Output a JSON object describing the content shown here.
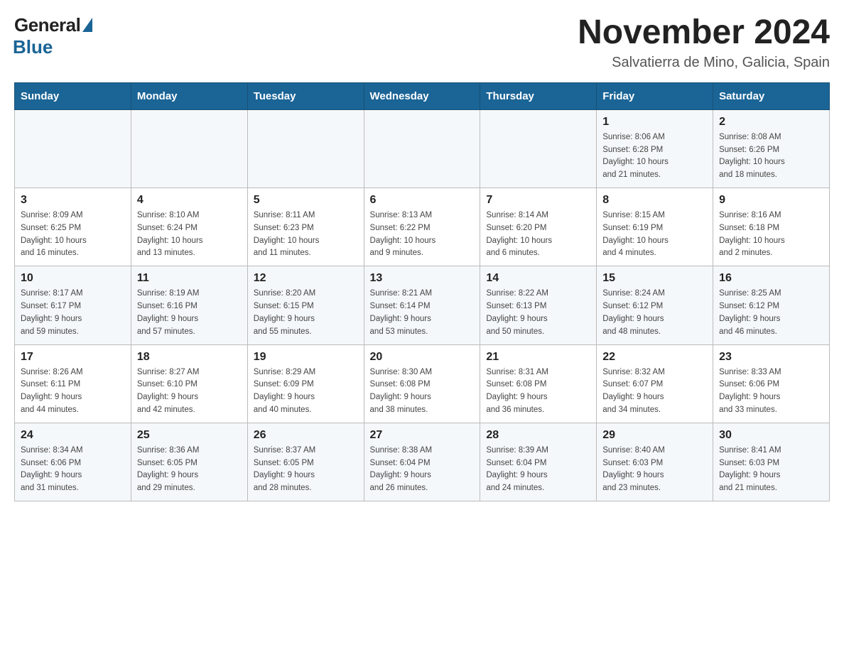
{
  "logo": {
    "general": "General",
    "blue": "Blue"
  },
  "header": {
    "title": "November 2024",
    "subtitle": "Salvatierra de Mino, Galicia, Spain"
  },
  "days_of_week": [
    "Sunday",
    "Monday",
    "Tuesday",
    "Wednesday",
    "Thursday",
    "Friday",
    "Saturday"
  ],
  "weeks": [
    [
      {
        "day": "",
        "info": ""
      },
      {
        "day": "",
        "info": ""
      },
      {
        "day": "",
        "info": ""
      },
      {
        "day": "",
        "info": ""
      },
      {
        "day": "",
        "info": ""
      },
      {
        "day": "1",
        "info": "Sunrise: 8:06 AM\nSunset: 6:28 PM\nDaylight: 10 hours\nand 21 minutes."
      },
      {
        "day": "2",
        "info": "Sunrise: 8:08 AM\nSunset: 6:26 PM\nDaylight: 10 hours\nand 18 minutes."
      }
    ],
    [
      {
        "day": "3",
        "info": "Sunrise: 8:09 AM\nSunset: 6:25 PM\nDaylight: 10 hours\nand 16 minutes."
      },
      {
        "day": "4",
        "info": "Sunrise: 8:10 AM\nSunset: 6:24 PM\nDaylight: 10 hours\nand 13 minutes."
      },
      {
        "day": "5",
        "info": "Sunrise: 8:11 AM\nSunset: 6:23 PM\nDaylight: 10 hours\nand 11 minutes."
      },
      {
        "day": "6",
        "info": "Sunrise: 8:13 AM\nSunset: 6:22 PM\nDaylight: 10 hours\nand 9 minutes."
      },
      {
        "day": "7",
        "info": "Sunrise: 8:14 AM\nSunset: 6:20 PM\nDaylight: 10 hours\nand 6 minutes."
      },
      {
        "day": "8",
        "info": "Sunrise: 8:15 AM\nSunset: 6:19 PM\nDaylight: 10 hours\nand 4 minutes."
      },
      {
        "day": "9",
        "info": "Sunrise: 8:16 AM\nSunset: 6:18 PM\nDaylight: 10 hours\nand 2 minutes."
      }
    ],
    [
      {
        "day": "10",
        "info": "Sunrise: 8:17 AM\nSunset: 6:17 PM\nDaylight: 9 hours\nand 59 minutes."
      },
      {
        "day": "11",
        "info": "Sunrise: 8:19 AM\nSunset: 6:16 PM\nDaylight: 9 hours\nand 57 minutes."
      },
      {
        "day": "12",
        "info": "Sunrise: 8:20 AM\nSunset: 6:15 PM\nDaylight: 9 hours\nand 55 minutes."
      },
      {
        "day": "13",
        "info": "Sunrise: 8:21 AM\nSunset: 6:14 PM\nDaylight: 9 hours\nand 53 minutes."
      },
      {
        "day": "14",
        "info": "Sunrise: 8:22 AM\nSunset: 6:13 PM\nDaylight: 9 hours\nand 50 minutes."
      },
      {
        "day": "15",
        "info": "Sunrise: 8:24 AM\nSunset: 6:12 PM\nDaylight: 9 hours\nand 48 minutes."
      },
      {
        "day": "16",
        "info": "Sunrise: 8:25 AM\nSunset: 6:12 PM\nDaylight: 9 hours\nand 46 minutes."
      }
    ],
    [
      {
        "day": "17",
        "info": "Sunrise: 8:26 AM\nSunset: 6:11 PM\nDaylight: 9 hours\nand 44 minutes."
      },
      {
        "day": "18",
        "info": "Sunrise: 8:27 AM\nSunset: 6:10 PM\nDaylight: 9 hours\nand 42 minutes."
      },
      {
        "day": "19",
        "info": "Sunrise: 8:29 AM\nSunset: 6:09 PM\nDaylight: 9 hours\nand 40 minutes."
      },
      {
        "day": "20",
        "info": "Sunrise: 8:30 AM\nSunset: 6:08 PM\nDaylight: 9 hours\nand 38 minutes."
      },
      {
        "day": "21",
        "info": "Sunrise: 8:31 AM\nSunset: 6:08 PM\nDaylight: 9 hours\nand 36 minutes."
      },
      {
        "day": "22",
        "info": "Sunrise: 8:32 AM\nSunset: 6:07 PM\nDaylight: 9 hours\nand 34 minutes."
      },
      {
        "day": "23",
        "info": "Sunrise: 8:33 AM\nSunset: 6:06 PM\nDaylight: 9 hours\nand 33 minutes."
      }
    ],
    [
      {
        "day": "24",
        "info": "Sunrise: 8:34 AM\nSunset: 6:06 PM\nDaylight: 9 hours\nand 31 minutes."
      },
      {
        "day": "25",
        "info": "Sunrise: 8:36 AM\nSunset: 6:05 PM\nDaylight: 9 hours\nand 29 minutes."
      },
      {
        "day": "26",
        "info": "Sunrise: 8:37 AM\nSunset: 6:05 PM\nDaylight: 9 hours\nand 28 minutes."
      },
      {
        "day": "27",
        "info": "Sunrise: 8:38 AM\nSunset: 6:04 PM\nDaylight: 9 hours\nand 26 minutes."
      },
      {
        "day": "28",
        "info": "Sunrise: 8:39 AM\nSunset: 6:04 PM\nDaylight: 9 hours\nand 24 minutes."
      },
      {
        "day": "29",
        "info": "Sunrise: 8:40 AM\nSunset: 6:03 PM\nDaylight: 9 hours\nand 23 minutes."
      },
      {
        "day": "30",
        "info": "Sunrise: 8:41 AM\nSunset: 6:03 PM\nDaylight: 9 hours\nand 21 minutes."
      }
    ]
  ]
}
